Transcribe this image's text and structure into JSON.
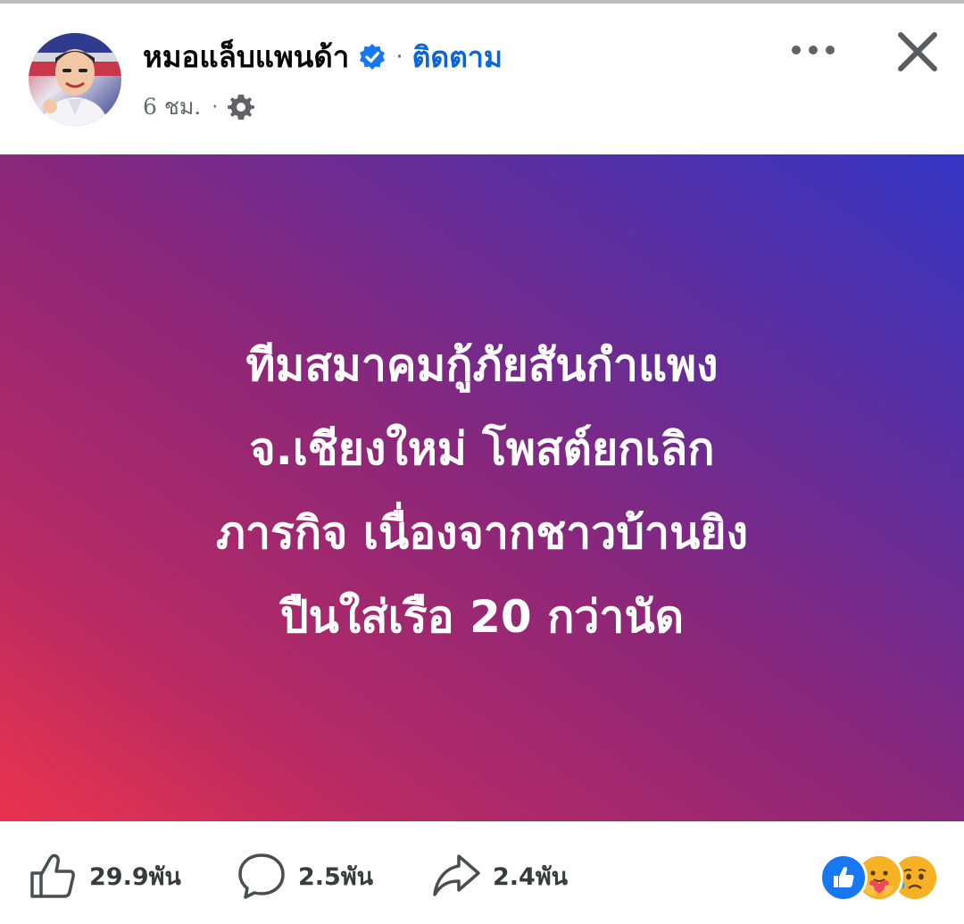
{
  "header": {
    "author_name": "หมอแล็บแพนด้า",
    "separator": "·",
    "follow_label": "ติดตาม",
    "post_time": "6 ชม.",
    "meta_separator": "·",
    "avatar_icon": "profile-photo",
    "verified_icon": "verified-badge-icon",
    "privacy_icon": "gear-icon",
    "more_icon": "more-horizontal-icon",
    "close_icon": "close-icon",
    "verified_color": "#1877f2",
    "follow_color": "#0a66d8"
  },
  "post": {
    "lines": [
      "ทีมสมาคมกู้ภัยสันกำแพง",
      "จ.เชียงใหม่ โพสต์ยกเลิก",
      "ภารกิจ เนื่องจากชาวบ้านยิง",
      "ปืนใส่เรือ 20 กว่านัด"
    ],
    "background_colors": [
      "#e9334e",
      "#8e2778",
      "#3435c4"
    ],
    "text_color": "#ffffff"
  },
  "footer": {
    "like_count": "29.9พัน",
    "comment_count": "2.5พัน",
    "share_count": "2.4พัน",
    "like_icon": "thumbs-up-icon",
    "comment_icon": "comment-bubble-icon",
    "share_icon": "share-arrow-icon",
    "reactions": [
      "like-reaction-icon",
      "care-reaction-icon",
      "sad-reaction-icon"
    ]
  }
}
